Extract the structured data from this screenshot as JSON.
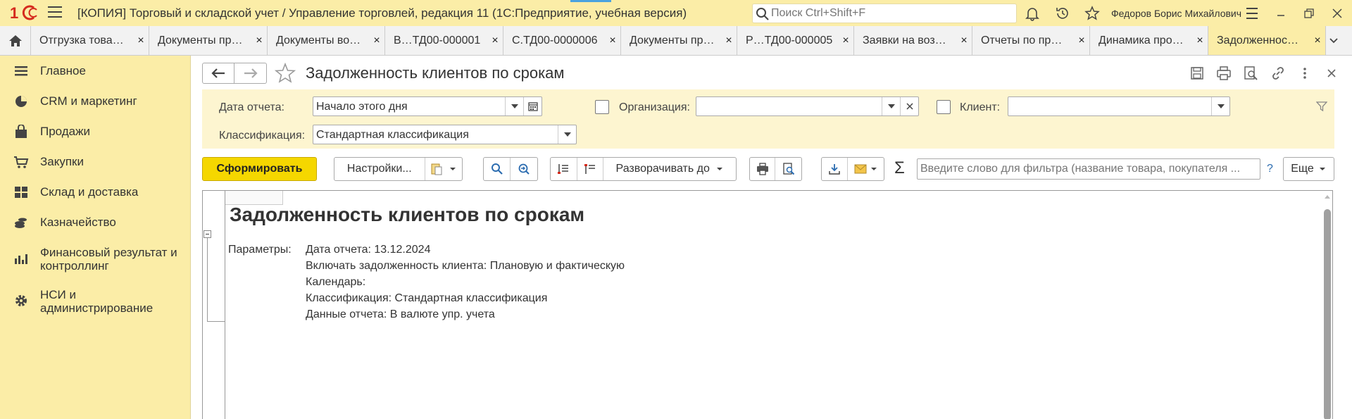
{
  "titlebar": {
    "title": "[КОПИЯ] Торговый и складской учет / Управление торговлей, редакция 11  (1С:Предприятие, учебная версия)",
    "search_placeholder": "Поиск Ctrl+Shift+F",
    "user": "Федоров Борис Михайлович"
  },
  "tabs": [
    {
      "label": "Отгрузка това…",
      "close": "×"
    },
    {
      "label": "Документы пр…",
      "close": "×"
    },
    {
      "label": "Документы во…",
      "close": "×"
    },
    {
      "label": "В…ТД00-000001",
      "close": "×"
    },
    {
      "label": "С.ТД00-0000006",
      "close": "×"
    },
    {
      "label": "Документы пр…",
      "close": "×"
    },
    {
      "label": "Р…ТД00-000005",
      "close": "×"
    },
    {
      "label": "Заявки на воз…",
      "close": "×"
    },
    {
      "label": "Отчеты по пр…",
      "close": "×"
    },
    {
      "label": "Динамика про…",
      "close": "×"
    },
    {
      "label": "Задолженнос…",
      "close": "×",
      "active": true
    }
  ],
  "sidebar": {
    "items": [
      {
        "label": "Главное",
        "icon": "menu-lines-icon"
      },
      {
        "label": "CRM и маркетинг",
        "icon": "pie-chart-icon"
      },
      {
        "label": "Продажи",
        "icon": "shopping-bag-icon"
      },
      {
        "label": "Закупки",
        "icon": "cart-icon"
      },
      {
        "label": "Склад и доставка",
        "icon": "warehouse-grid-icon"
      },
      {
        "label": "Казначейство",
        "icon": "coins-icon"
      },
      {
        "label": "Финансовый результат и контроллинг",
        "icon": "bar-chart-icon"
      },
      {
        "label": "НСИ и администрирование",
        "icon": "gear-icon"
      }
    ]
  },
  "form": {
    "title": "Задолженность клиентов по срокам"
  },
  "params": {
    "report_date_label": "Дата отчета:",
    "report_date_value": "Начало этого дня",
    "organization_label": "Организация:",
    "organization_value": "",
    "client_label": "Клиент:",
    "client_value": "",
    "classification_label": "Классификация:",
    "classification_value": "Стандартная классификация"
  },
  "commands": {
    "generate": "Сформировать",
    "settings": "Настройки...",
    "expand_to": "Разворачивать до",
    "filter_placeholder": "Введите слово для фильтра (название товара, покупателя ...",
    "help": "?",
    "more": "Еще",
    "sum": "Σ"
  },
  "report": {
    "title": "Задолженность клиентов по срокам",
    "params_label": "Параметры:",
    "lines": [
      "Дата отчета: 13.12.2024",
      "Включать задолженность клиента: Плановую и фактическую",
      "Календарь:",
      "Классификация: Стандартная классификация",
      "Данные отчета: В валюте упр. учета"
    ]
  },
  "colors": {
    "accent_yellow": "#fbeda7",
    "primary_button": "#f5d700",
    "logo_red": "#d52b1e"
  }
}
